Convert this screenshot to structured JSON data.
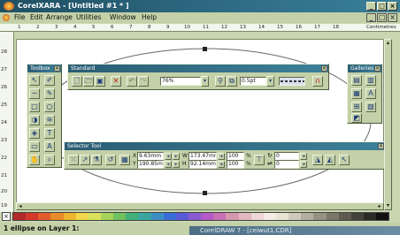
{
  "window": {
    "title": "CorelXARA - [Untitled #1 * ]"
  },
  "menu": [
    "File",
    "Edit",
    "Arrange",
    "Utilities",
    "Window",
    "Help"
  ],
  "ruler": {
    "ticks": [
      "1",
      "2",
      "3",
      "4",
      "5",
      "6",
      "7",
      "8",
      "9",
      "10",
      "11",
      "12",
      "13",
      "14",
      "15",
      "16",
      "17",
      "18"
    ],
    "unit_label": "Centimetres",
    "v_ticks": [
      "28",
      "27",
      "26",
      "25",
      "24",
      "23",
      "22",
      "21",
      "20",
      "19"
    ]
  },
  "toolbars": {
    "toolbox": {
      "title": "Toolbox"
    },
    "standard": {
      "title": "Standard",
      "zoom": "76%",
      "line_width": "0.5pt"
    },
    "galleries": {
      "title": "Galleries"
    },
    "selector": {
      "title": "Selector Tool",
      "x": "9.63mm",
      "y": "190.85mm",
      "w": "173.47mm",
      "h": "92.14mm",
      "scale_w": "100",
      "scale_h": "100",
      "rotate": "0",
      "shear": "0"
    }
  },
  "palette_colors": [
    "#b22a2a",
    "#d43a2c",
    "#e25b2a",
    "#e98a2a",
    "#efb52f",
    "#f2d84a",
    "#d8e25a",
    "#a6d35c",
    "#6fc25f",
    "#43b07a",
    "#3aa6a2",
    "#3a8fc2",
    "#3a6ed6",
    "#5a5ad6",
    "#8a5ad0",
    "#b25ac6",
    "#c96fb5",
    "#d696b0",
    "#e2b8c0",
    "#eed6d6",
    "#f4ece4",
    "#e8e4d4",
    "#cfcabb",
    "#b2ae9f",
    "#969282",
    "#7a7668",
    "#5e5a50",
    "#44403a",
    "#2c2a26",
    "#121110"
  ],
  "status": {
    "text": "1 ellipse on Layer 1:"
  },
  "taskbar": {
    "text": "CorelDRAW 7 - [ceiwut1.CDR]"
  }
}
